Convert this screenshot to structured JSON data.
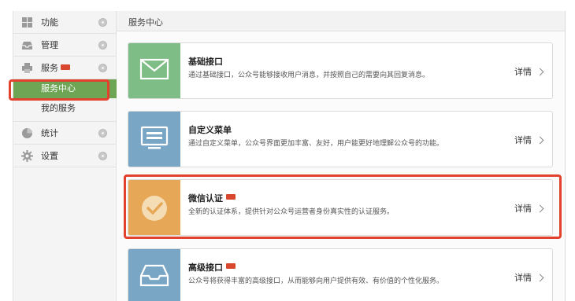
{
  "sidebar": {
    "items": [
      {
        "label": "功能",
        "icon": "grid-icon"
      },
      {
        "label": "管理",
        "icon": "inbox-icon"
      },
      {
        "label": "服务",
        "icon": "printer-icon",
        "badge": "new"
      },
      {
        "label": "统计",
        "icon": "pie-chart-icon"
      },
      {
        "label": "设置",
        "icon": "gear-icon"
      }
    ],
    "sub_items": [
      {
        "label": "服务中心",
        "active": true
      },
      {
        "label": "我的服务",
        "active": false
      }
    ]
  },
  "main": {
    "header_title": "服务中心",
    "detail_label": "详情",
    "cards": [
      {
        "title": "基础接口",
        "description": "通过基础接口，公众号能够接收用户消息，并按照自己的需要向其回复消息。",
        "icon": "envelope-icon",
        "color": "#7ebd85"
      },
      {
        "title": "自定义菜单",
        "description": "通过自定义菜单，公众号界面更加丰富、友好，用户能更好地理解公众号的功能。",
        "icon": "monitor-icon",
        "color": "#7aa6c6"
      },
      {
        "title": "微信认证",
        "description": "全新的认证体系，提供针对公众号运营者身份真实性的认证服务。",
        "icon": "checkmark-icon",
        "color": "#e6a757",
        "badge": "new"
      },
      {
        "title": "高级接口",
        "description": "公众号将获得丰富的高级接口，从而能够向用户提供有效、有价值的个性化服务。",
        "icon": "tray-icon",
        "color": "#7aa6c6",
        "badge": "new"
      }
    ]
  },
  "colors": {
    "active_green": "#6ea555",
    "highlight_red": "#e2412d",
    "new_badge": "#d9462e"
  }
}
